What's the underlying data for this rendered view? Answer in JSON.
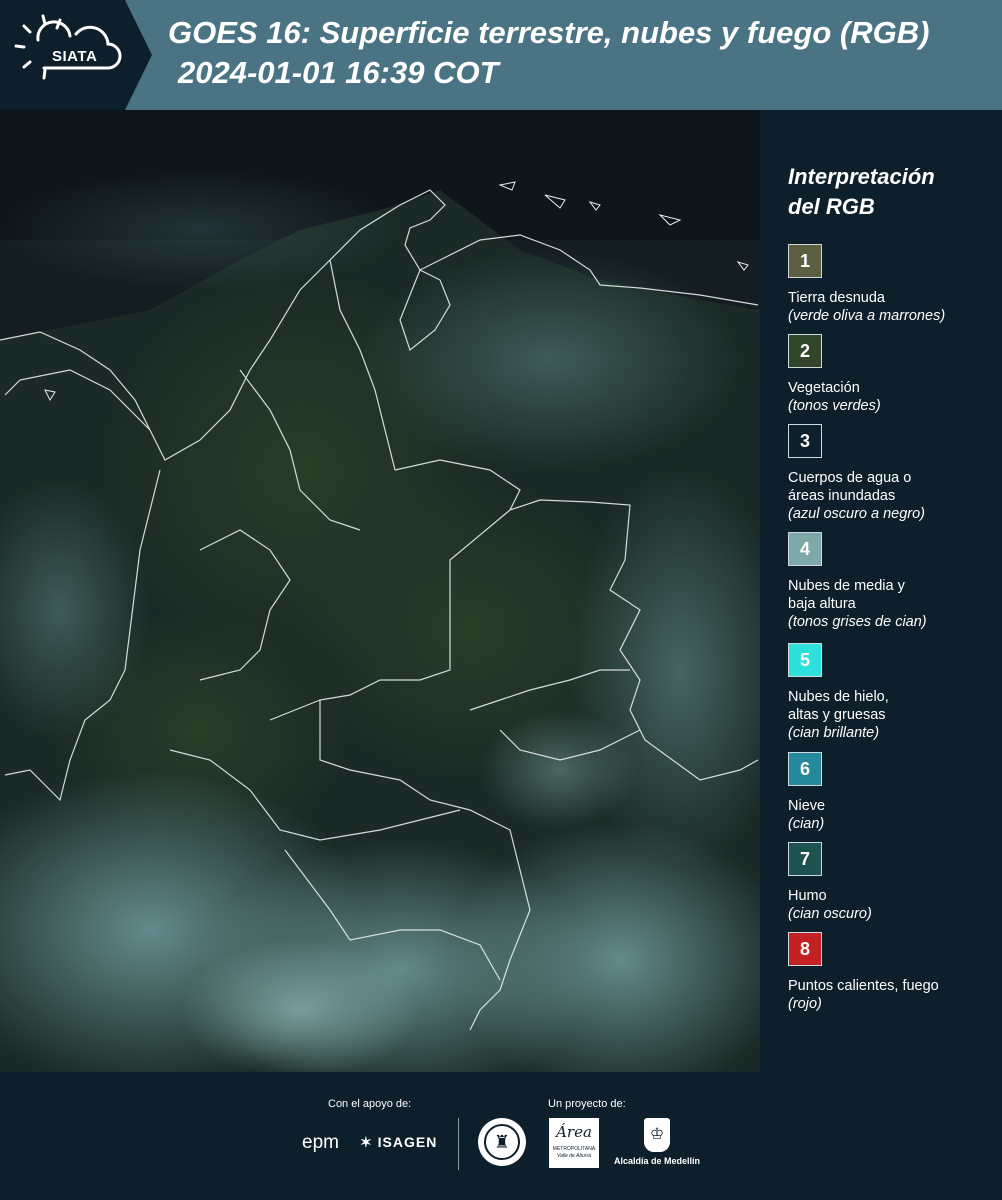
{
  "header": {
    "logo_text": "SIATA",
    "title": "GOES 16: Superficie terrestre, nubes y fuego (RGB)",
    "subtitle": "2024-01-01 16:39 COT"
  },
  "legend": {
    "title_line1": "Interpretación",
    "title_line2": "del RGB",
    "items": [
      {
        "number": "1",
        "color": "#5c5e42",
        "label_lines": [
          "Tierra desnuda"
        ],
        "note": "(verde oliva a marrones)"
      },
      {
        "number": "2",
        "color": "#33452a",
        "label_lines": [
          "Vegetación"
        ],
        "note": "(tonos verdes)"
      },
      {
        "number": "3",
        "color": "#0d1f2b",
        "label_lines": [
          "Cuerpos de agua o",
          "áreas inundadas"
        ],
        "note": "(azul oscuro a negro)"
      },
      {
        "number": "4",
        "color": "#7da9a9",
        "label_lines": [
          "Nubes de media y",
          "baja altura"
        ],
        "note": "(tonos grises de cian)"
      },
      {
        "number": "5",
        "color": "#2ee0dc",
        "label_lines": [
          "Nubes de hielo,",
          "altas y gruesas"
        ],
        "note": "(cian brillante)"
      },
      {
        "number": "6",
        "color": "#26899b",
        "label_lines": [
          "Nieve"
        ],
        "note": "(cian)"
      },
      {
        "number": "7",
        "color": "#1c5250",
        "label_lines": [
          "Humo"
        ],
        "note": "(cian oscuro)"
      },
      {
        "number": "8",
        "color": "#c42124",
        "label_lines": [
          "Puntos calientes, fuego"
        ],
        "note": "(rojo)"
      }
    ]
  },
  "footer": {
    "support_label": "Con el apoyo de:",
    "project_label": "Un proyecto de:",
    "sponsors": [
      "epm",
      "ISAGEN"
    ],
    "partners": [
      "Área",
      "METROPOLITANA",
      "Valle de Aburrá",
      "Alcaldía de Medellín"
    ]
  }
}
